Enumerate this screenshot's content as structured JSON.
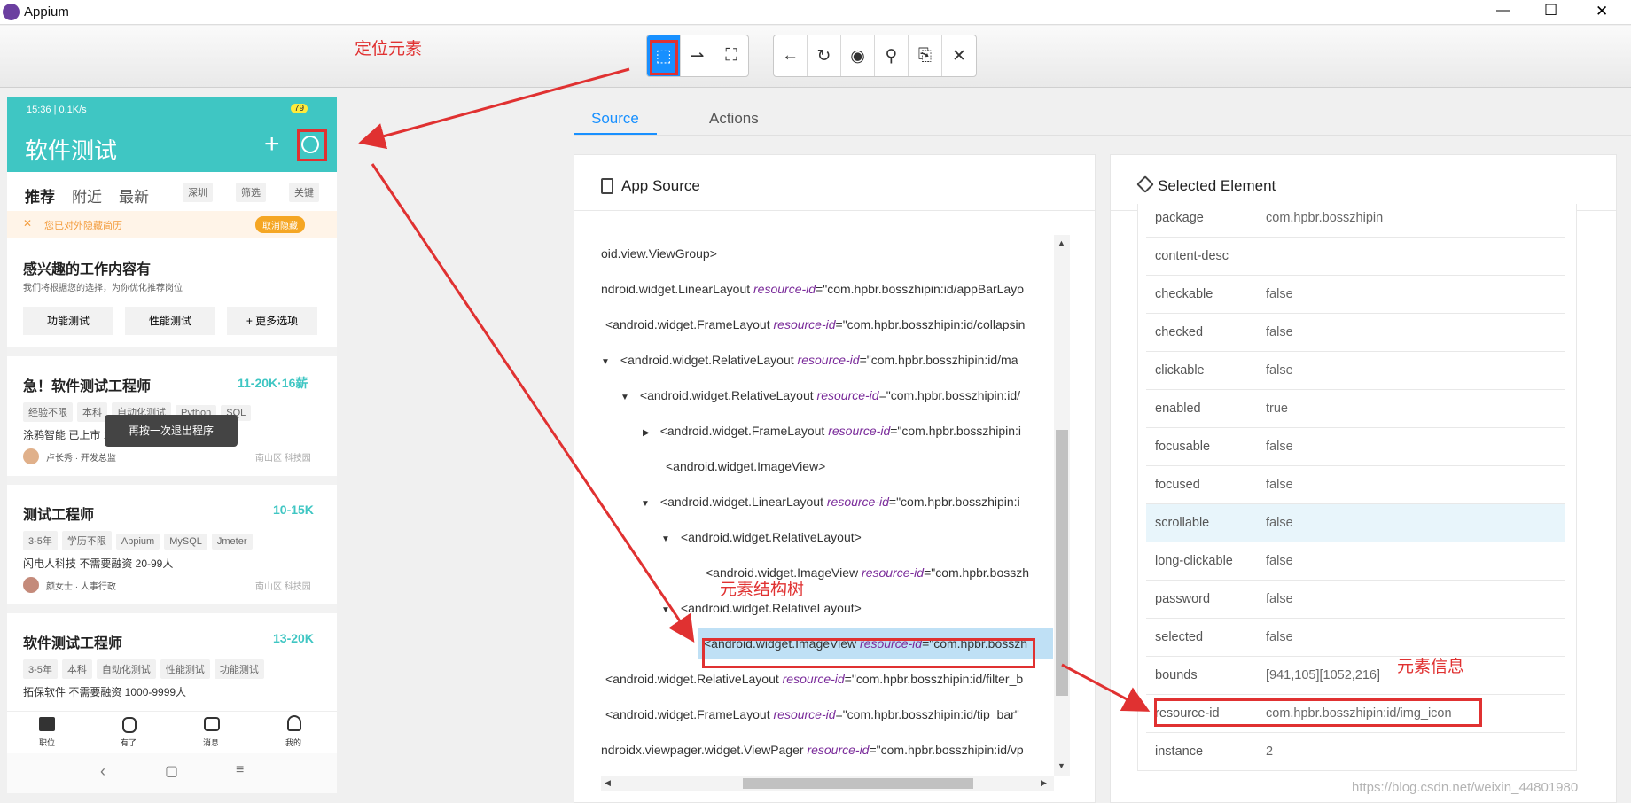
{
  "window": {
    "title": "Appium",
    "min": "—",
    "max": "☐",
    "close": "✕"
  },
  "toolbar": {
    "left_btns": [
      "⬚",
      "⇀",
      "⛶"
    ],
    "right_btns": [
      "←",
      "↻",
      "◉",
      "⚲",
      "⎘",
      "✕"
    ]
  },
  "annotations": {
    "locate": "定位元素",
    "tree": "元素结构树",
    "info": "元素信息"
  },
  "phone": {
    "status": "15:36 | 0.1K/s",
    "battery": "79",
    "title": "软件测试",
    "plus": "+",
    "tabs": [
      "推荐",
      "附近",
      "最新"
    ],
    "filters": [
      "深圳",
      "筛选",
      "关键"
    ],
    "banner": "您已对外隐藏简历",
    "banner_btn": "取消隐藏",
    "interest_title": "感兴趣的工作内容有",
    "interest_sub": "我们将根据您的选择，为你优化推荐岗位",
    "interest_btns": [
      "功能测试",
      "性能测试",
      "+ 更多选项"
    ],
    "toast": "再按一次退出程序",
    "jobs": [
      {
        "title": "急！软件测试工程师",
        "salary": "11-20K·16薪",
        "tags": [
          "经验不限",
          "本科",
          "自动化测试",
          "Python",
          "SQL"
        ],
        "company": "涂鸦智能  已上市  1000-9999人",
        "recruiter": "卢长秀 · 开发总监",
        "location": "南山区  科技园"
      },
      {
        "title": "测试工程师",
        "salary": "10-15K",
        "tags": [
          "3-5年",
          "学历不限",
          "Appium",
          "MySQL",
          "Jmeter"
        ],
        "company": "闪电人科技  不需要融资  20-99人",
        "recruiter": "颜女士 · 人事行政",
        "location": "南山区  科技园"
      },
      {
        "title": "软件测试工程师",
        "salary": "13-20K",
        "tags": [
          "3-5年",
          "本科",
          "自动化测试",
          "性能测试",
          "功能测试"
        ],
        "company": "拓保软件  不需要融资  1000-9999人",
        "recruiter": "",
        "location": ""
      }
    ],
    "nav": [
      "职位",
      "有了",
      "消息",
      "我的"
    ],
    "sys": [
      "‹",
      "▢",
      "≡"
    ]
  },
  "inspector": {
    "tabs": [
      "Source",
      "Actions"
    ],
    "source_title": "App Source",
    "tree": [
      {
        "tag": "oid.view.ViewGroup>",
        "attr": "",
        "val": ""
      },
      {
        "tag": "ndroid.widget.LinearLayout ",
        "attr": "resource-id",
        "val": "=\"com.hpbr.bosszhipin:id/appBarLayo"
      },
      {
        "tag": "<android.widget.FrameLayout ",
        "attr": "resource-id",
        "val": "=\"com.hpbr.bosszhipin:id/collapsin"
      },
      {
        "tag": "<android.widget.RelativeLayout ",
        "attr": "resource-id",
        "val": "=\"com.hpbr.bosszhipin:id/ma"
      },
      {
        "tag": "<android.widget.RelativeLayout ",
        "attr": "resource-id",
        "val": "=\"com.hpbr.bosszhipin:id/"
      },
      {
        "tag": "<android.widget.FrameLayout ",
        "attr": "resource-id",
        "val": "=\"com.hpbr.bosszhipin:i"
      },
      {
        "tag": "<android.widget.ImageView>",
        "attr": "",
        "val": ""
      },
      {
        "tag": "<android.widget.LinearLayout ",
        "attr": "resource-id",
        "val": "=\"com.hpbr.bosszhipin:i"
      },
      {
        "tag": "<android.widget.RelativeLayout>",
        "attr": "",
        "val": ""
      },
      {
        "tag": "<android.widget.ImageView ",
        "attr": "resource-id",
        "val": "=\"com.hpbr.bosszh"
      },
      {
        "tag": "<android.widget.RelativeLayout>",
        "attr": "",
        "val": ""
      },
      {
        "tag": "<android.widget.ImageView ",
        "attr": "resource-id",
        "val": "=\"com.hpbr.bosszh"
      },
      {
        "tag": "<android.widget.RelativeLayout ",
        "attr": "resource-id",
        "val": "=\"com.hpbr.bosszhipin:id/filter_b"
      },
      {
        "tag": "<android.widget.FrameLayout ",
        "attr": "resource-id",
        "val": "=\"com.hpbr.bosszhipin:id/tip_bar\""
      },
      {
        "tag": "ndroidx.viewpager.widget.ViewPager ",
        "attr": "resource-id",
        "val": "=\"com.hpbr.bosszhipin:id/vp"
      }
    ],
    "selected_title": "Selected Element",
    "props": [
      {
        "k": "package",
        "v": "com.hpbr.bosszhipin"
      },
      {
        "k": "content-desc",
        "v": ""
      },
      {
        "k": "checkable",
        "v": "false"
      },
      {
        "k": "checked",
        "v": "false"
      },
      {
        "k": "clickable",
        "v": "false"
      },
      {
        "k": "enabled",
        "v": "true"
      },
      {
        "k": "focusable",
        "v": "false"
      },
      {
        "k": "focused",
        "v": "false"
      },
      {
        "k": "scrollable",
        "v": "false"
      },
      {
        "k": "long-clickable",
        "v": "false"
      },
      {
        "k": "password",
        "v": "false"
      },
      {
        "k": "selected",
        "v": "false"
      },
      {
        "k": "bounds",
        "v": "[941,105][1052,216]"
      },
      {
        "k": "resource-id",
        "v": "com.hpbr.bosszhipin:id/img_icon"
      },
      {
        "k": "instance",
        "v": "2"
      }
    ],
    "watermark": "https://blog.csdn.net/weixin_44801980"
  }
}
